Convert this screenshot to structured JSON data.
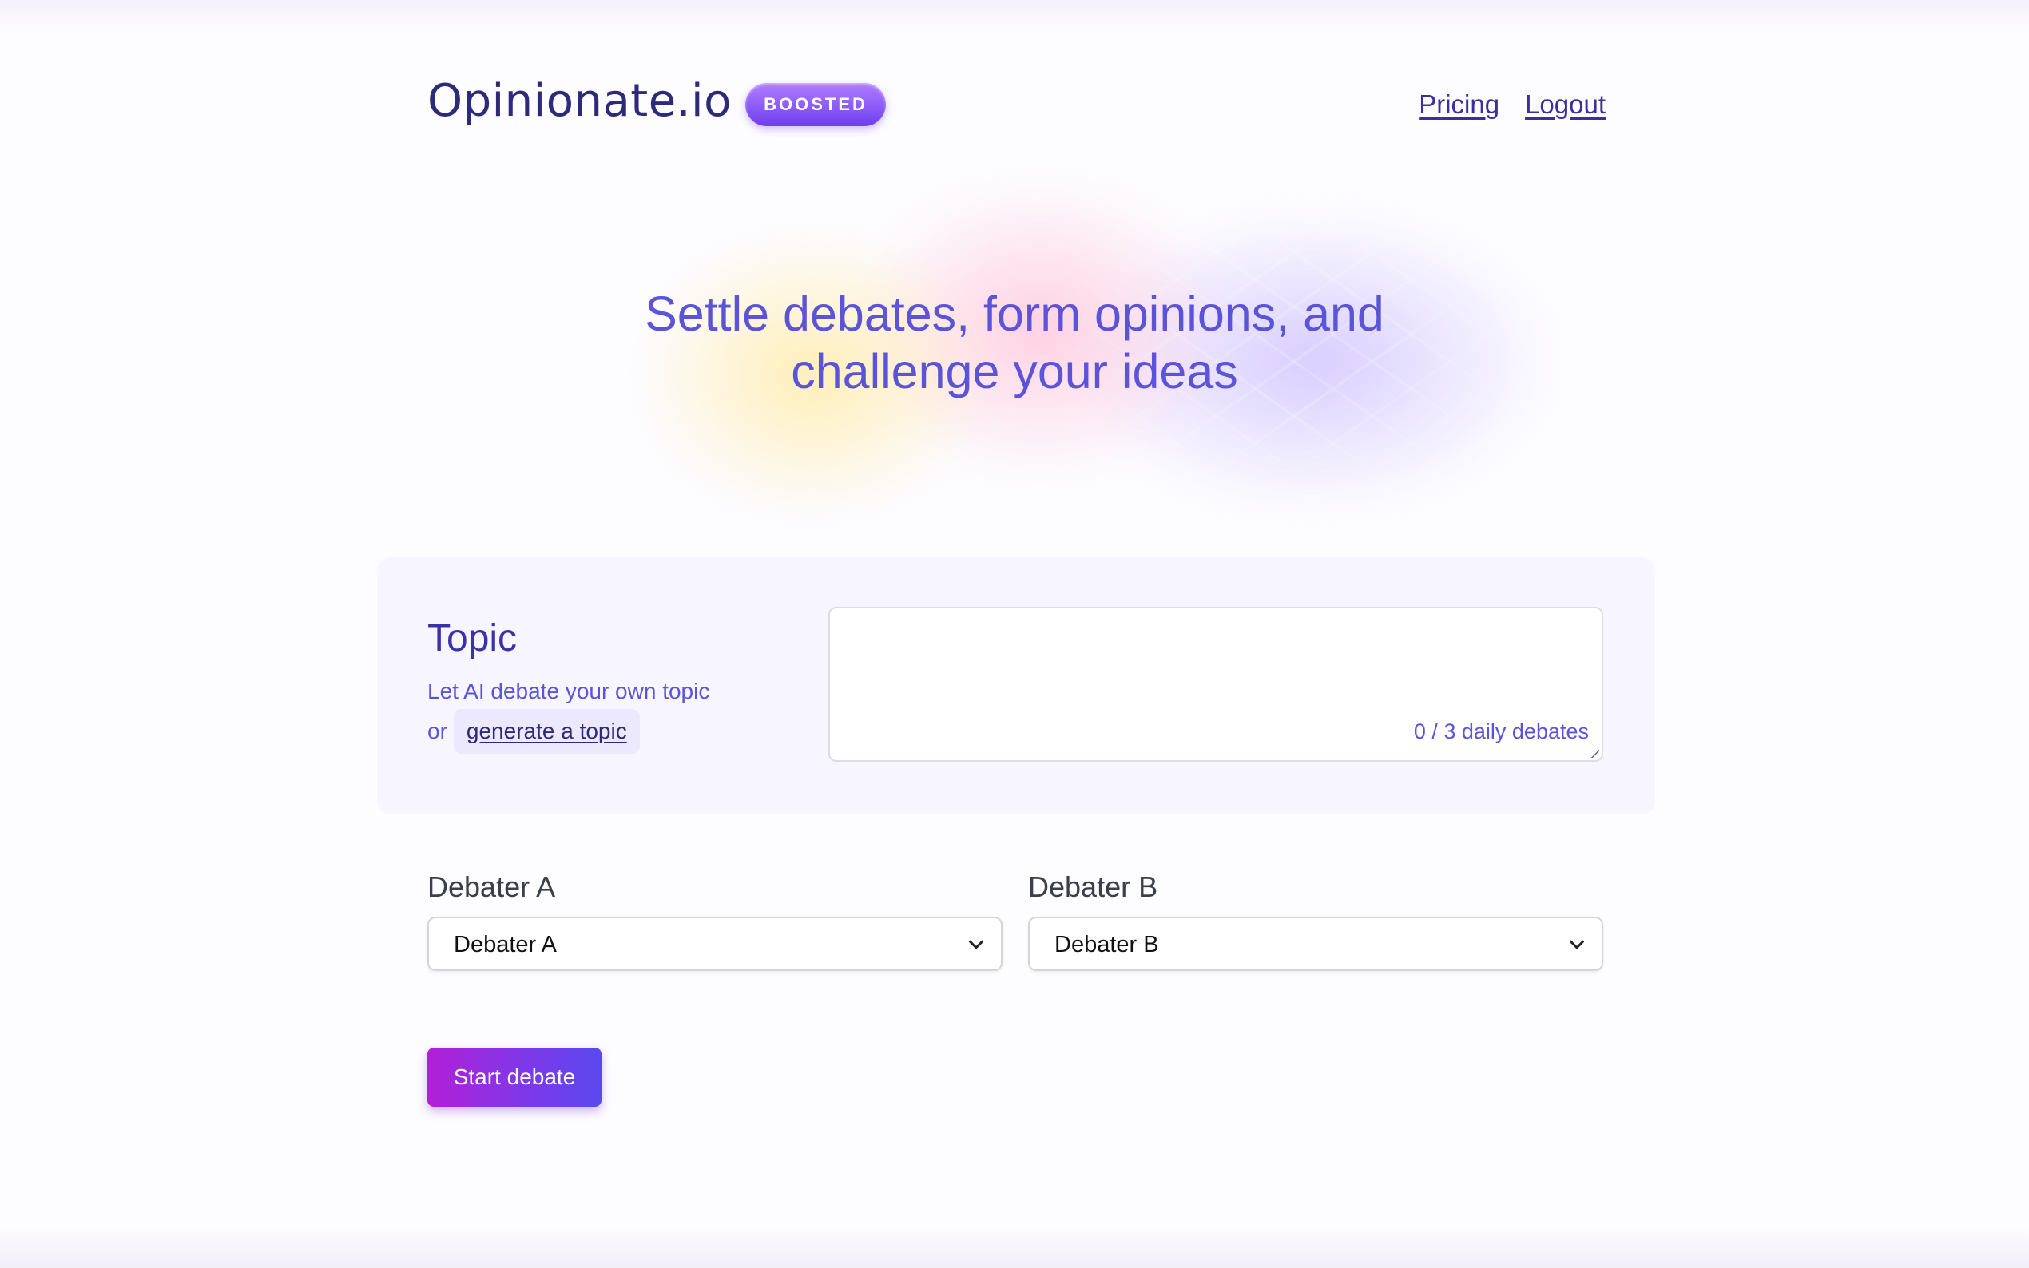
{
  "header": {
    "brand": "Opinionate.io",
    "badge": "BOOSTED",
    "nav": {
      "pricing": "Pricing",
      "logout": "Logout"
    }
  },
  "hero": {
    "line1": "Settle debates, form opinions, and",
    "line2": "challenge your ideas"
  },
  "topic": {
    "title": "Topic",
    "subtitle": "Let AI debate your own topic",
    "or": "or",
    "generate_link": "generate a topic",
    "input_value": "",
    "counter": "0 / 3 daily debates"
  },
  "debaters": {
    "a": {
      "label": "Debater A",
      "selected": "Debater A"
    },
    "b": {
      "label": "Debater B",
      "selected": "Debater B"
    }
  },
  "actions": {
    "start": "Start debate"
  },
  "colors": {
    "brand": "#2d2a7a",
    "accent": "#5b54d9",
    "badge_gradient_start": "#b07bff",
    "badge_gradient_end": "#6d3df0",
    "button_gradient_start": "#b11fd6",
    "button_gradient_end": "#5a48ee"
  },
  "icons": {
    "select_caret": "chevron-down-icon"
  }
}
